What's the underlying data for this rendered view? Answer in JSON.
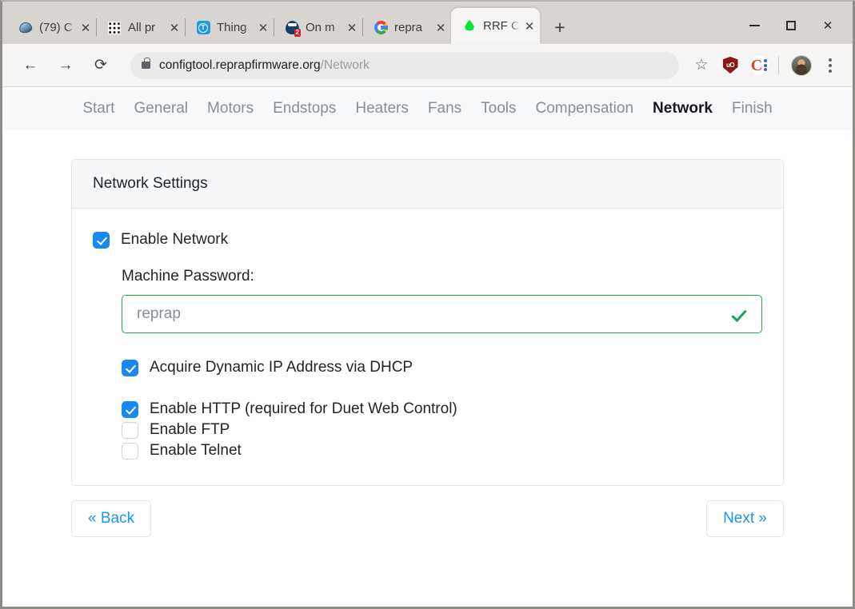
{
  "browser": {
    "tabs": [
      {
        "title": "(79) C",
        "favicon": "disc-icon"
      },
      {
        "title": "All pr",
        "favicon": "grid-icon"
      },
      {
        "title": "Thing",
        "favicon": "thingiverse-icon"
      },
      {
        "title": "On m",
        "favicon": "onshape-icon",
        "badge": "2"
      },
      {
        "title": "repra",
        "favicon": "google-icon"
      },
      {
        "title": "RRF C",
        "favicon": "droplet-icon",
        "active": true
      }
    ],
    "new_tab_label": "+",
    "window_controls": {
      "minimize": "minimize-button",
      "maximize": "maximize-button",
      "close": "✕"
    },
    "toolbar": {
      "back": "←",
      "forward": "→",
      "reload": "⟳",
      "url_domain": "configtool.reprapfirmware.org",
      "url_path": "/Network",
      "bookmark": "☆",
      "extension_ublock": "uO",
      "extension_colorzilla": "C"
    }
  },
  "nav": {
    "items": [
      {
        "label": "Start",
        "active": false
      },
      {
        "label": "General",
        "active": false
      },
      {
        "label": "Motors",
        "active": false
      },
      {
        "label": "Endstops",
        "active": false
      },
      {
        "label": "Heaters",
        "active": false
      },
      {
        "label": "Fans",
        "active": false
      },
      {
        "label": "Tools",
        "active": false
      },
      {
        "label": "Compensation",
        "active": false
      },
      {
        "label": "Network",
        "active": true
      },
      {
        "label": "Finish",
        "active": false
      }
    ]
  },
  "card": {
    "title": "Network Settings",
    "enable_network": {
      "label": "Enable Network",
      "checked": true
    },
    "password": {
      "label": "Machine Password:",
      "placeholder": "reprap",
      "value": "",
      "valid": true
    },
    "dhcp": {
      "label": "Acquire Dynamic IP Address via DHCP",
      "checked": true
    },
    "protocols": [
      {
        "label": "Enable HTTP (required for Duet Web Control)",
        "checked": true
      },
      {
        "label": "Enable FTP",
        "checked": false
      },
      {
        "label": "Enable Telnet",
        "checked": false
      }
    ]
  },
  "footer": {
    "back_label": "« Back",
    "next_label": "Next »"
  },
  "colors": {
    "accent_blue": "#1a88f0",
    "link_blue": "#1a94f5",
    "valid_green": "#28a745",
    "nav_muted": "#868e96",
    "nav_active": "#16181b"
  }
}
